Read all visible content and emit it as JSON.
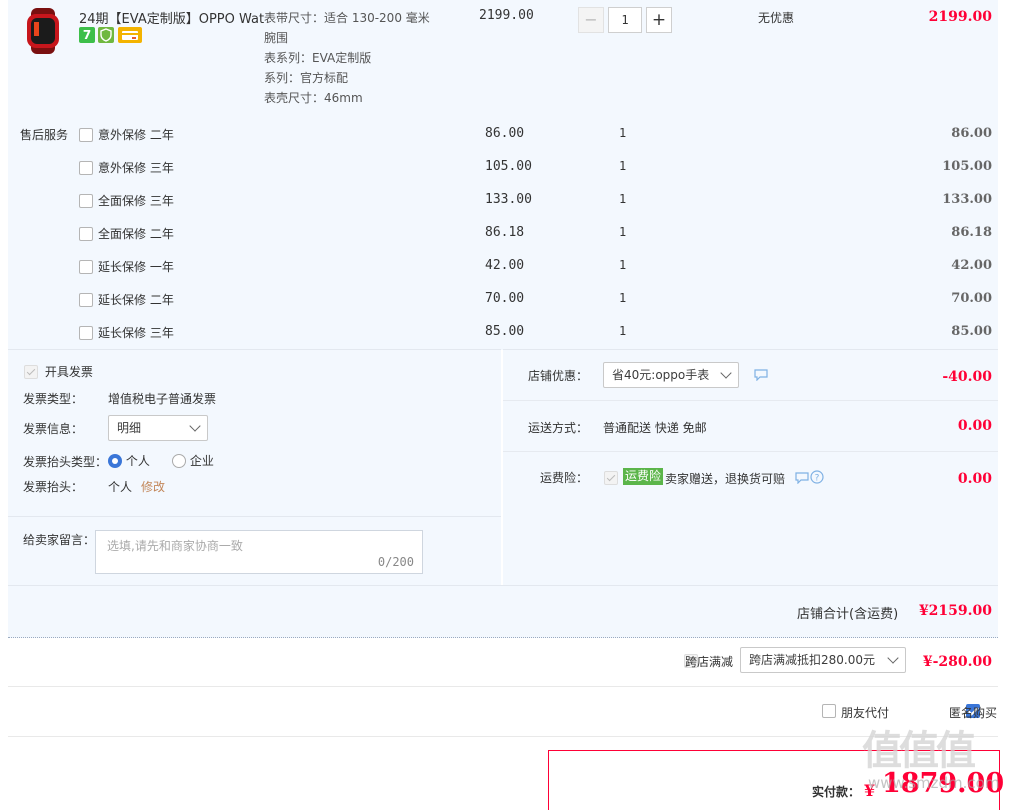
{
  "item": {
    "title": "24期【EVA定制版】OPPO Wat...",
    "specs": [
      "表带尺寸：适合 130-200 毫米",
      "腕围",
      "表系列：EVA定制版",
      "系列：官方标配",
      "表壳尺寸：46mm"
    ],
    "price": "2199.00",
    "qty": "1",
    "discount": "无优惠",
    "subtotal": "2199.00",
    "badges": {
      "seven": "7"
    }
  },
  "service": {
    "label": "售后服务",
    "rows": [
      {
        "name": "意外保修 二年",
        "price": "86.00",
        "qty": "1",
        "total": "86.00"
      },
      {
        "name": "意外保修 三年",
        "price": "105.00",
        "qty": "1",
        "total": "105.00"
      },
      {
        "name": "全面保修 三年",
        "price": "133.00",
        "qty": "1",
        "total": "133.00"
      },
      {
        "name": "全面保修 二年",
        "price": "86.18",
        "qty": "1",
        "total": "86.18"
      },
      {
        "name": "延长保修 一年",
        "price": "42.00",
        "qty": "1",
        "total": "42.00"
      },
      {
        "name": "延长保修 二年",
        "price": "70.00",
        "qty": "1",
        "total": "70.00"
      },
      {
        "name": "延长保修 三年",
        "price": "85.00",
        "qty": "1",
        "total": "85.00"
      }
    ]
  },
  "invoice": {
    "open_label": "开具发票",
    "type_label": "发票类型：",
    "type_value": "增值税电子普通发票",
    "info_label": "发票信息：",
    "info_value": "明细",
    "header_type_label": "发票抬头类型：",
    "opt_personal": "个人",
    "opt_company": "企业",
    "header_label": "发票抬头：",
    "header_value": "个人",
    "edit": "修改"
  },
  "message": {
    "label": "给卖家留言：",
    "placeholder": "选填,请先和商家协商一致",
    "counter": "0/200"
  },
  "shop": {
    "discount_label": "店铺优惠：",
    "discount_value": "省40元:oppo手表",
    "discount_amount": "-40.00",
    "shipping_label": "运送方式：",
    "shipping_value": "普通配送 快递 免邮",
    "shipping_amount": "0.00",
    "insurance_label": "运费险：",
    "insurance_tag": "运费险",
    "insurance_text": "卖家赠送，退换货可赔",
    "insurance_amount": "0.00",
    "total_label": "店铺合计(含运费)",
    "total_value": "¥2159.00"
  },
  "cross": {
    "label": "跨店满减",
    "select_value": "跨店满减抵扣280.00元",
    "amount": "¥-280.00"
  },
  "options": {
    "friend_pay": "朋友代付",
    "anonymous": "匿名购买"
  },
  "pay": {
    "label": "实付款：",
    "currency": "¥",
    "amount": "1879.00"
  },
  "watermark": {
    "text": "值值值",
    "sub": "www.smzdm.com"
  },
  "colors": {
    "accent": "#ff0036",
    "bg": "#f3f8fe",
    "blue": "#3a76d8",
    "green": "#5bb54a"
  }
}
